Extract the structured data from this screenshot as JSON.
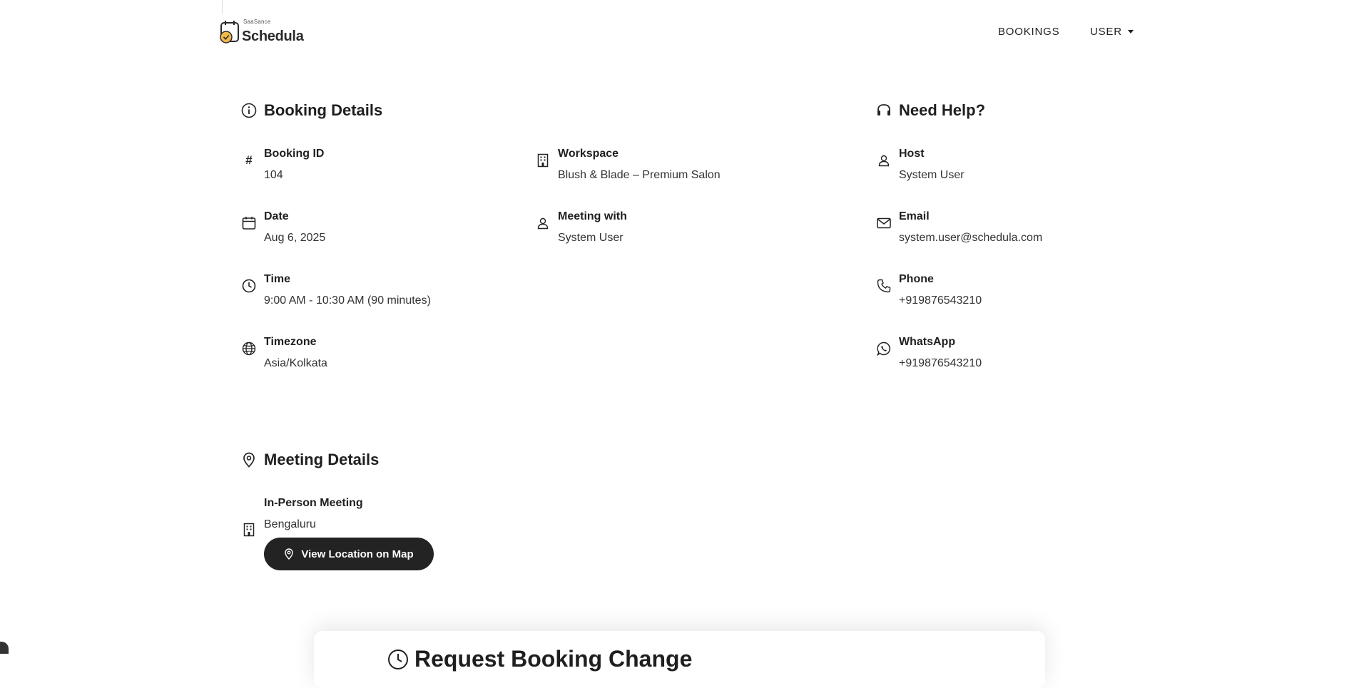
{
  "brand": {
    "tagline": "SaaSance",
    "name": "Schedula",
    "accent_color": "#f2b84b"
  },
  "nav": {
    "bookings": "BOOKINGS",
    "user": "USER"
  },
  "booking_details": {
    "title": "Booking Details",
    "fields": {
      "booking_id": {
        "label": "Booking ID",
        "value": "104",
        "icon": "hash-icon"
      },
      "date": {
        "label": "Date",
        "value": "Aug 6, 2025",
        "icon": "calendar-icon"
      },
      "time": {
        "label": "Time",
        "value": "9:00 AM - 10:30 AM (90 minutes)",
        "icon": "clock-icon"
      },
      "timezone": {
        "label": "Timezone",
        "value": "Asia/Kolkata",
        "icon": "globe-icon"
      },
      "workspace": {
        "label": "Workspace",
        "value": "Blush & Blade – Premium Salon",
        "icon": "building-icon"
      },
      "meeting_with": {
        "label": "Meeting with",
        "value": "System User",
        "icon": "user-icon"
      }
    }
  },
  "help": {
    "title": "Need Help?",
    "fields": {
      "host": {
        "label": "Host",
        "value": "System User",
        "icon": "user-icon"
      },
      "email": {
        "label": "Email",
        "value": "system.user@schedula.com",
        "icon": "mail-icon"
      },
      "phone": {
        "label": "Phone",
        "value": "+919876543210",
        "icon": "phone-icon"
      },
      "whatsapp": {
        "label": "WhatsApp",
        "value": "+919876543210",
        "icon": "whatsapp-icon"
      }
    }
  },
  "meeting_details": {
    "title": "Meeting Details",
    "type_label": "In-Person Meeting",
    "location": "Bengaluru",
    "map_button": "View Location on Map"
  },
  "request_change": {
    "title": "Request Booking Change"
  }
}
